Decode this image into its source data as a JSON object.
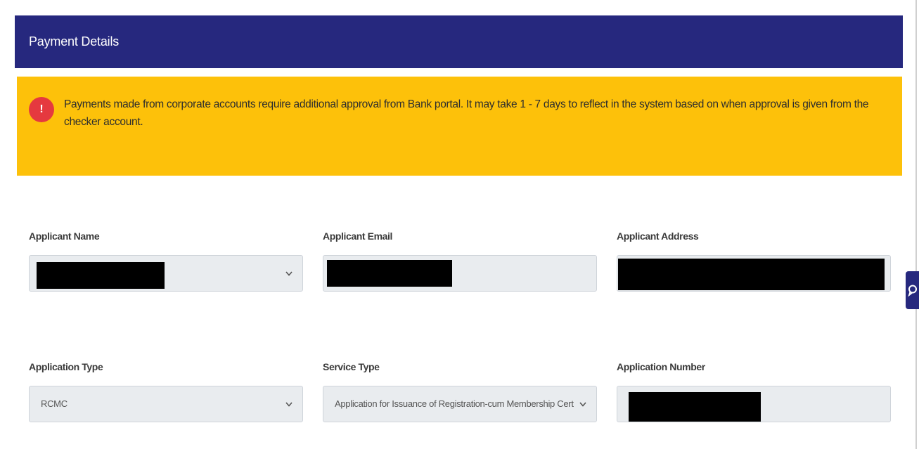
{
  "header": {
    "title": "Payment Details"
  },
  "alert": {
    "icon": "exclamation-icon",
    "text": "Payments made from corporate accounts require additional approval from Bank portal. It may take 1 - 7 days to reflect in the system based on when approval is given from the checker account.",
    "color": "#fdc10a"
  },
  "fields": {
    "applicant_name": {
      "label": "Applicant Name",
      "value": ""
    },
    "applicant_email": {
      "label": "Applicant Email",
      "value": ""
    },
    "applicant_address": {
      "label": "Applicant Address",
      "value": ""
    },
    "application_type": {
      "label": "Application Type",
      "value": "RCMC"
    },
    "service_type": {
      "label": "Service Type",
      "value": "Application for Issuance of Registration-cum Membership Certifi"
    },
    "application_number": {
      "label": "Application Number",
      "value": ""
    }
  },
  "colors": {
    "header_bg": "#26287e",
    "alert_icon": "#e5393f",
    "field_bg": "#e9ecef"
  },
  "chat": {
    "icon": "chat-icon"
  }
}
